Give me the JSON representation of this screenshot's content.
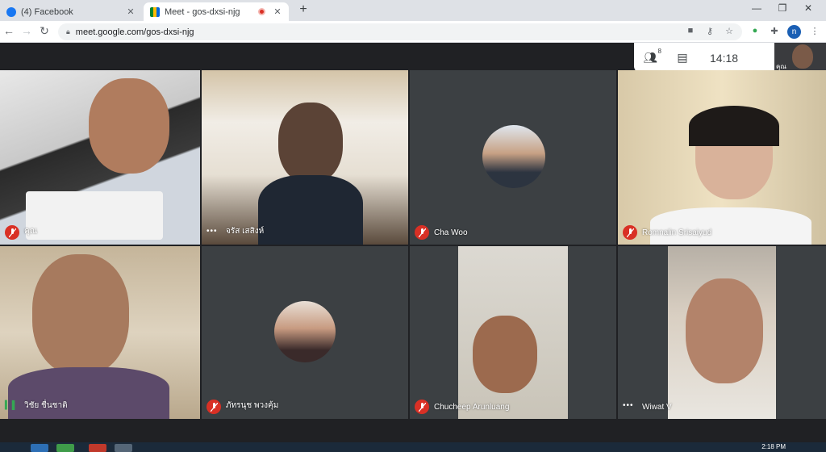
{
  "browser": {
    "tabs": [
      {
        "title": "(4) Facebook",
        "favicon": "facebook-icon",
        "active": false
      },
      {
        "title": "Meet - gos-dxsi-njg",
        "favicon": "meet-icon",
        "active": true,
        "recording": true
      }
    ],
    "url": "meet.google.com/gos-dxsi-njg",
    "profile_initial": "n"
  },
  "meet": {
    "participant_count": "8",
    "time": "14:18",
    "self_label": "คุณ",
    "participants": [
      {
        "name": "คุณ",
        "muted": true
      },
      {
        "name": "จรัส เสสิงห์",
        "muted": false
      },
      {
        "name": "Cha Woo",
        "muted": true
      },
      {
        "name": "Romnalin Srisaiyud",
        "muted": true
      },
      {
        "name": "วิชัย ชื่นชาติ",
        "muted": false
      },
      {
        "name": "ภัทรนุช พวงคุ้ม",
        "muted": true
      },
      {
        "name": "Chucheep Arunluang",
        "muted": true
      },
      {
        "name": "Wiwat V",
        "muted": false
      }
    ]
  },
  "taskbar": {
    "time": "2:18 PM"
  },
  "colors": {
    "meet_bg": "#202124",
    "tile_bg": "#3c4043",
    "mic_off": "#d93025",
    "accent": "#1a73e8"
  }
}
